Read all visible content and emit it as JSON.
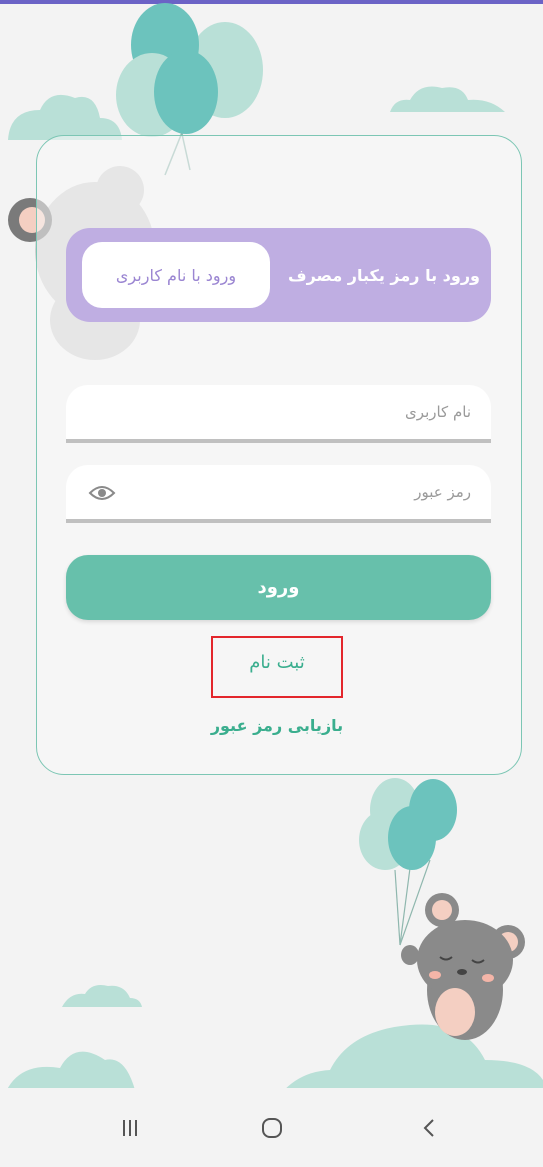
{
  "login_toggle": {
    "username_tab": "ورود با نام کاربری",
    "otp_tab": "ورود با رمز یکبار مصرف"
  },
  "form": {
    "username_placeholder": "نام کاربری",
    "password_placeholder": "رمز عبور",
    "login_button": "ورود",
    "register_link": "ثبت نام",
    "forgot_password_link": "بازیابی رمز عبور"
  },
  "colors": {
    "accent_purple": "#bfaee2",
    "primary_green": "#67c0ab",
    "link_green": "#3aae8e",
    "highlight_red": "#e3262c"
  },
  "navigation_bar": {
    "icons": [
      "recent-apps-icon",
      "home-icon",
      "back-icon"
    ]
  }
}
